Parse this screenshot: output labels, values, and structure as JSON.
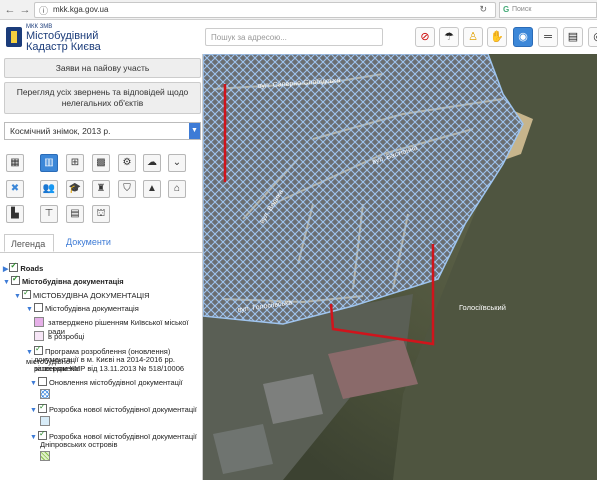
{
  "browser": {
    "url": "mkk.kga.gov.ua",
    "search_placeholder": "Поиск"
  },
  "header": {
    "logo_small": "МКК ЗМВ",
    "logo_title_line1": "Містобудівний",
    "logo_title_line2": "Кадастр Києва",
    "address_search_placeholder": "Пошук за адресою..."
  },
  "panel": {
    "share_button": "Заяви на пайову участь",
    "review_button_line1": "Перегляд усіх звернень та відповідей щодо",
    "review_button_line2": "нелегальних об'єктів",
    "basemap_select": "Космічний знімок, 2013 р.",
    "tabs": {
      "legend": "Легенда",
      "documents": "Документи"
    },
    "tree": {
      "roads": "Roads",
      "urban_docs": "Містобудівна документація",
      "urban_docs_caps": "МІСТОБУДІВНА ДОКУМЕНТАЦІЯ",
      "urban_docs_item": "Містобудівна документація",
      "approved": "затверджено рішенням Київської міської ради",
      "in_progress": "в розробці",
      "program_line1": "Програма розроблення (оновлення) містобудівної",
      "program_line2": "документації в м. Києві на 2014-2016 рр. затверджена",
      "program_line3": "рішенням КМР від 13.11.2013 № 518/10006",
      "update_docs": "Оновлення містобудівної документації",
      "new_docs_1": "Розробка нової містобудівної документації",
      "new_docs_2": "Розробка нової містобудівної документації",
      "islands": "Дніпровських островів"
    }
  },
  "map": {
    "labels": {
      "street_top": "вул. Саперно-Слобідська",
      "street_mid": "вул. Бастіонна",
      "street_bottom": "вул. Голосіївська",
      "street_vert": "вул. Велика",
      "park": "Голосіївський"
    }
  },
  "colors": {
    "brand": "#1b3c7a",
    "selected": "#3c87d8",
    "hatch": "#9fc4ee",
    "boundary": "#d0141c"
  }
}
